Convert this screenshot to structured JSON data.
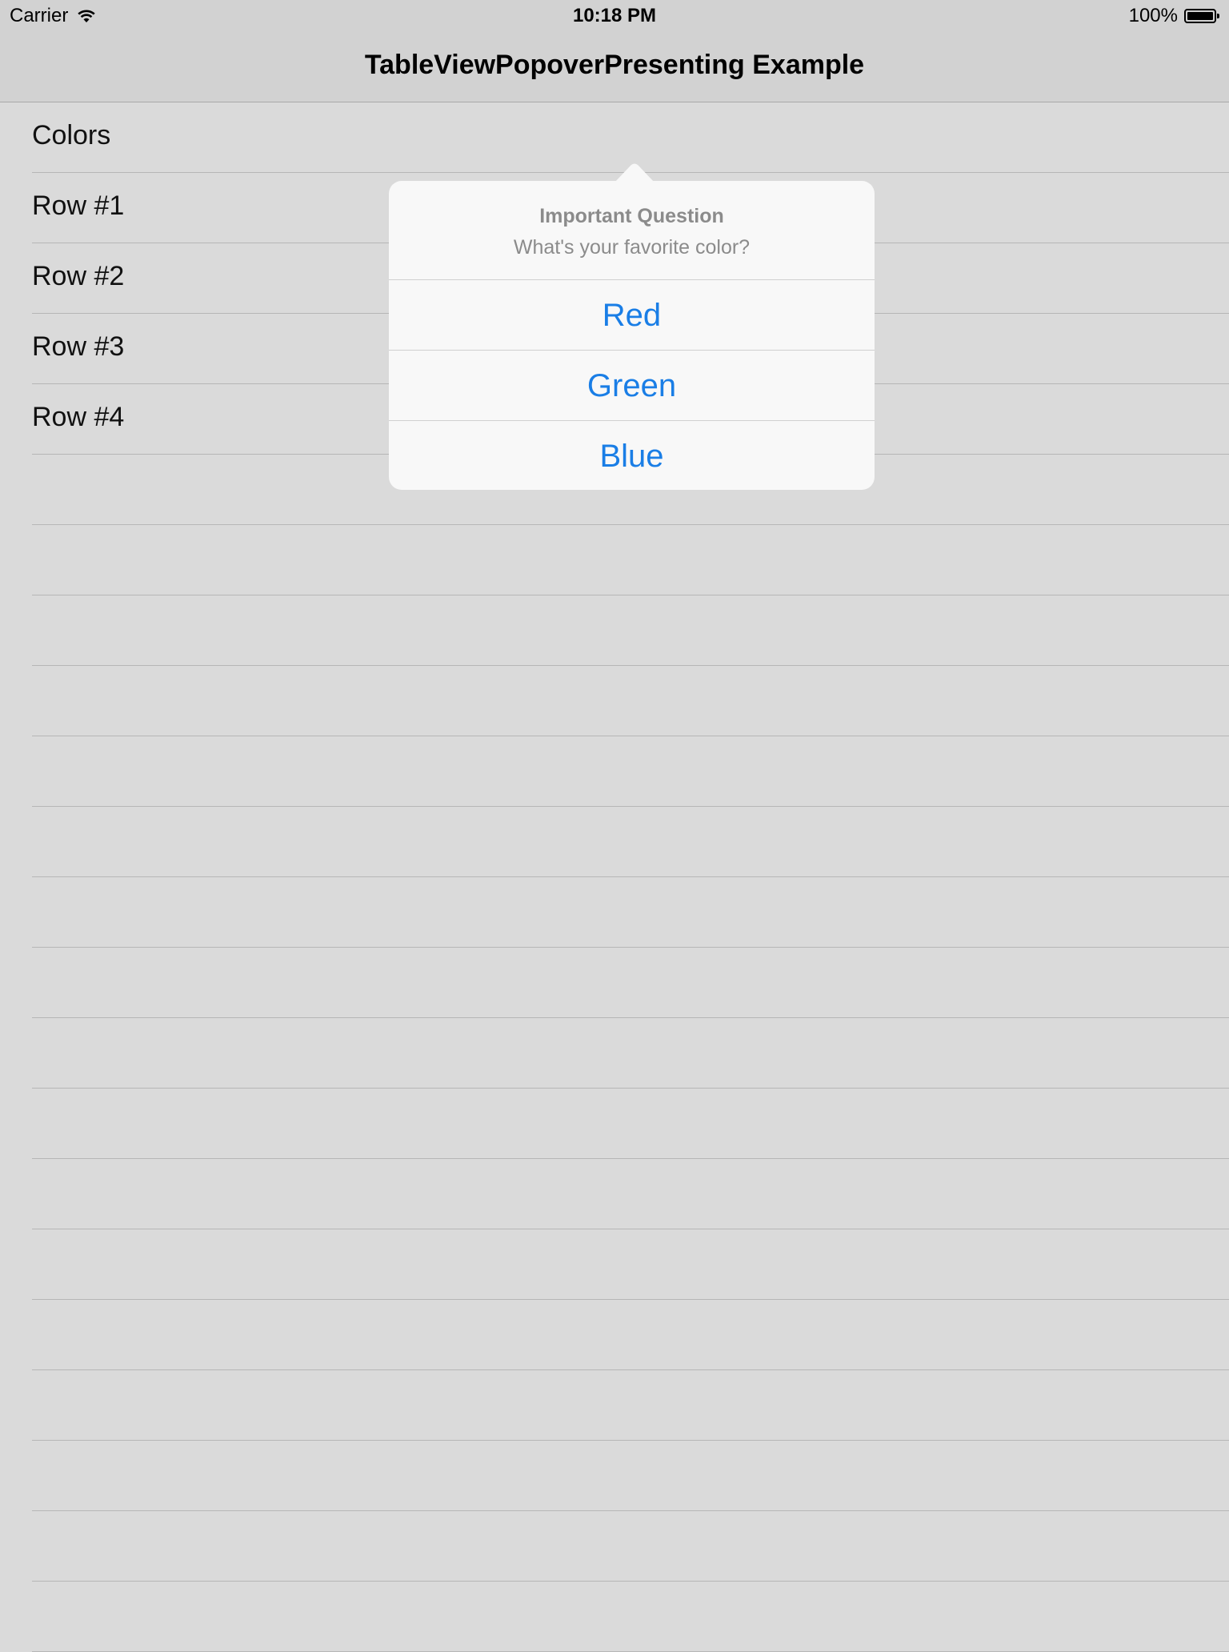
{
  "status_bar": {
    "carrier": "Carrier",
    "time": "10:18 PM",
    "battery": "100%"
  },
  "nav": {
    "title": "TableViewPopoverPresenting Example"
  },
  "table": {
    "rows": [
      {
        "label": "Colors"
      },
      {
        "label": "Row #1"
      },
      {
        "label": "Row #2"
      },
      {
        "label": "Row #3"
      },
      {
        "label": "Row #4"
      },
      {
        "label": ""
      },
      {
        "label": ""
      },
      {
        "label": ""
      },
      {
        "label": ""
      },
      {
        "label": ""
      },
      {
        "label": ""
      },
      {
        "label": ""
      },
      {
        "label": ""
      },
      {
        "label": ""
      },
      {
        "label": ""
      },
      {
        "label": ""
      },
      {
        "label": ""
      },
      {
        "label": ""
      },
      {
        "label": ""
      },
      {
        "label": ""
      },
      {
        "label": ""
      },
      {
        "label": ""
      },
      {
        "label": ""
      }
    ]
  },
  "popover": {
    "title": "Important Question",
    "message": "What's your favorite color?",
    "options": [
      {
        "label": "Red"
      },
      {
        "label": "Green"
      },
      {
        "label": "Blue"
      }
    ]
  },
  "colors": {
    "accent": "#1a7ee6",
    "background": "#dadada",
    "bar": "#d2d2d2"
  }
}
